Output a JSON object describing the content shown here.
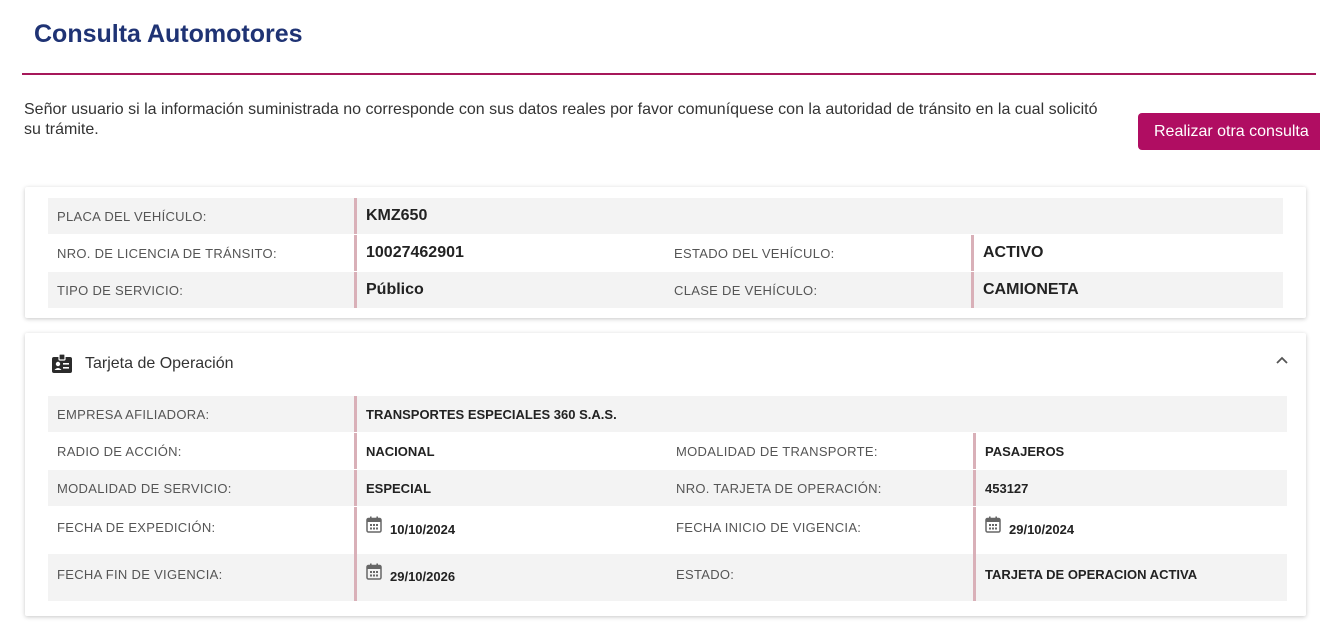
{
  "page": {
    "title": "Consulta Automotores",
    "notice": "Señor usuario si la información suministrada no corresponde con sus datos reales por favor comuníquese con la autoridad de tránsito en la cual solicitó su trámite.",
    "new_query_button": "Realizar otra consulta"
  },
  "vehicle": {
    "placa_label": "PLACA DEL VEHÍCULO:",
    "placa_value": "KMZ650",
    "licencia_label": "NRO. DE LICENCIA DE TRÁNSITO:",
    "licencia_value": "10027462901",
    "estado_label": "ESTADO DEL VEHÍCULO:",
    "estado_value": "ACTIVO",
    "servicio_label": "TIPO DE SERVICIO:",
    "servicio_value": "Público",
    "clase_label": "CLASE DE VEHÍCULO:",
    "clase_value": "CAMIONETA"
  },
  "operation_card": {
    "section_title": "Tarjeta de Operación",
    "section_icon": "id-badge-icon",
    "collapse_icon": "chevron-up-icon",
    "empresa_label": "EMPRESA AFILIADORA:",
    "empresa_value": "TRANSPORTES ESPECIALES 360 S.A.S.",
    "radio_label": "RADIO DE ACCIÓN:",
    "radio_value": "NACIONAL",
    "modalidad_transporte_label": "MODALIDAD DE TRANSPORTE:",
    "modalidad_transporte_value": "PASAJEROS",
    "modalidad_servicio_label": "MODALIDAD DE SERVICIO:",
    "modalidad_servicio_value": "ESPECIAL",
    "nro_tarjeta_label": "NRO. TARJETA DE OPERACIÓN:",
    "nro_tarjeta_value": "453127",
    "expedicion_label": "FECHA DE EXPEDICIÓN:",
    "expedicion_value": "10/10/2024",
    "inicio_label": "FECHA INICIO DE VIGENCIA:",
    "inicio_value": "29/10/2024",
    "fin_label": "FECHA FIN DE VIGENCIA:",
    "fin_value": "29/10/2026",
    "estado_label": "ESTADO:",
    "estado_value": "TARJETA DE OPERACION ACTIVA"
  },
  "colors": {
    "title": "#1f3374",
    "accent": "#b00d62",
    "rule": "#a6185a",
    "row_shade": "#f3f3f3",
    "value_border": "#d9b0b8"
  }
}
